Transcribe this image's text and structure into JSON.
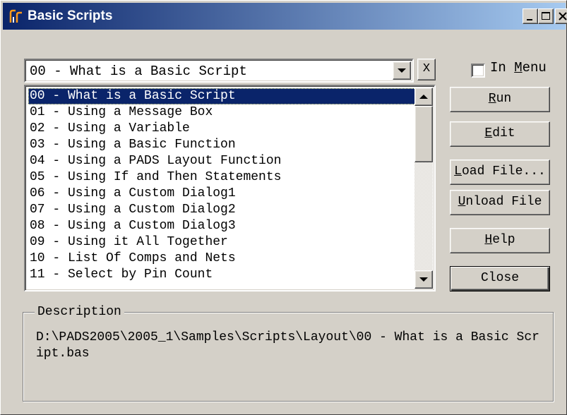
{
  "window": {
    "title": "Basic Scripts",
    "accent": "#0a246a",
    "controls": [
      "minimize-icon",
      "maximize-icon",
      "close-icon"
    ]
  },
  "script_select": {
    "value": "00 - What is a Basic Script",
    "clear_label": "X"
  },
  "in_menu": {
    "label": "In Menu",
    "checked": false
  },
  "script_list": {
    "items": [
      "00 - What is a Basic Script",
      "01 - Using a Message Box",
      "02 - Using a Variable",
      "03 - Using a Basic Function",
      "04 - Using a PADS Layout Function",
      "05 - Using If and Then Statements",
      "06 - Using a Custom Dialog1",
      "07 - Using a Custom Dialog2",
      "08 - Using a Custom Dialog3",
      "09 - Using it All Together",
      "10 - List Of Comps and Nets",
      "11 - Select by Pin Count"
    ],
    "selected_index": 0
  },
  "buttons": {
    "run": "Run",
    "edit": "Edit",
    "load_file": "Load File...",
    "unload_file": "Unload File",
    "help": "Help",
    "close": "Close"
  },
  "description": {
    "label": "Description",
    "text": "D:\\PADS2005\\2005_1\\Samples\\Scripts\\Layout\\00 - What is a Basic Script.bas"
  }
}
